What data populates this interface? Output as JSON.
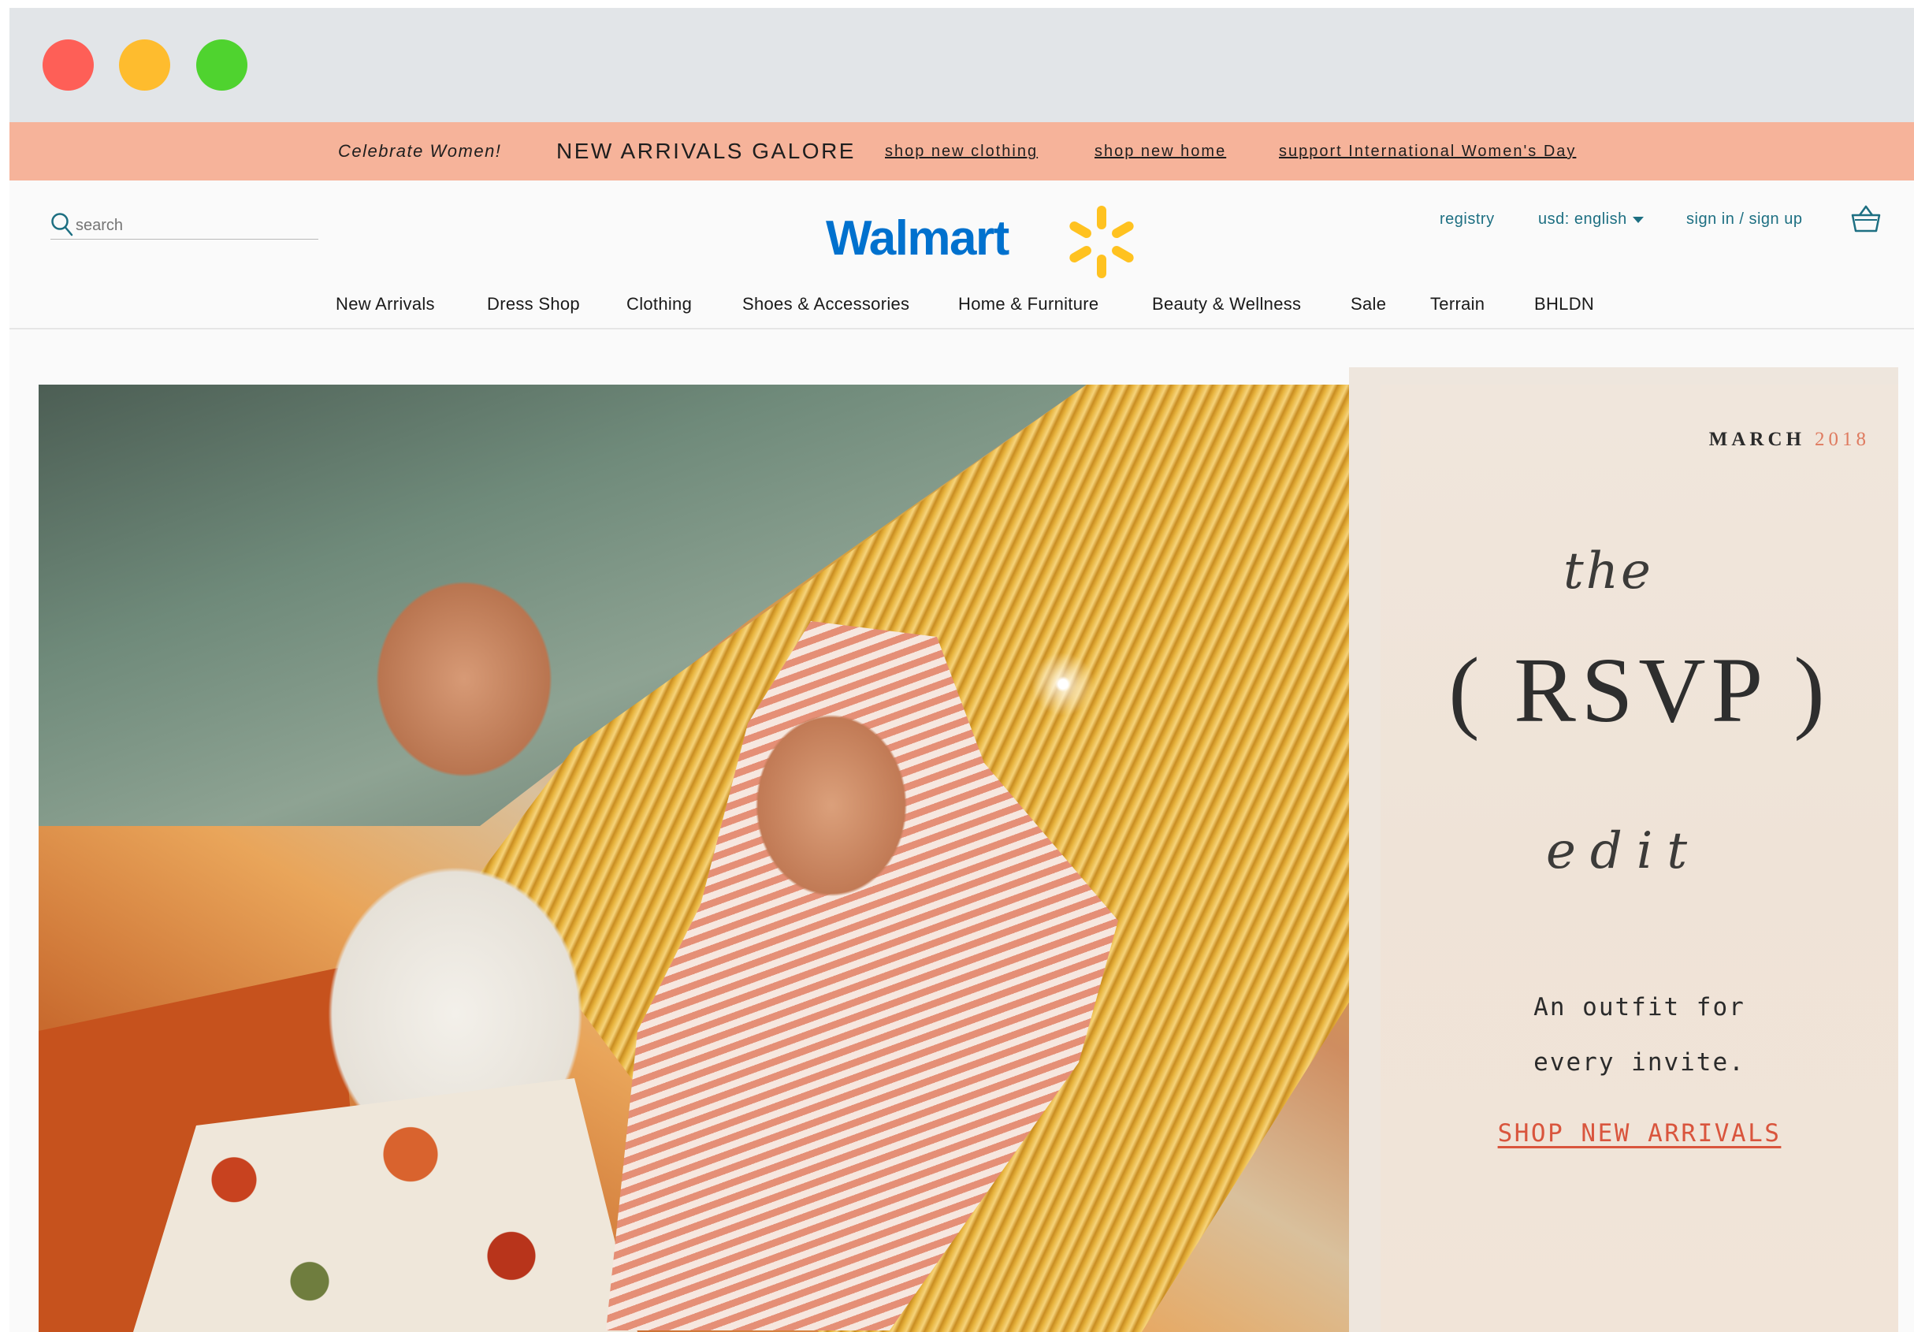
{
  "window": {
    "controls": [
      "close",
      "minimize",
      "maximize"
    ]
  },
  "promo_bar": {
    "tagline": "Celebrate Women!",
    "headline": "NEW ARRIVALS GALORE",
    "links": [
      "shop new clothing",
      "shop new home",
      "support International Women's Day"
    ]
  },
  "header": {
    "search_placeholder": "search",
    "logo_text": "Walmart",
    "registry_label": "registry",
    "currency_label": "usd: english",
    "sign_in_label": "sign in / sign up",
    "icons": [
      "search-icon",
      "spark-logo-icon",
      "chevron-down-icon",
      "shopping-basket-icon"
    ]
  },
  "nav": {
    "items": [
      "New Arrivals",
      "Dress Shop",
      "Clothing",
      "Shoes & Accessories",
      "Home & Furniture",
      "Beauty & Wellness",
      "Sale",
      "Terrain",
      "BHLDN"
    ]
  },
  "hero_panel": {
    "month": "MARCH",
    "year": "2018",
    "script_top": "the",
    "title": "( RSVP )",
    "script_bottom": "edit",
    "subtitle_line1": "An outfit for",
    "subtitle_line2": "every invite.",
    "cta": "SHOP NEW ARRIVALS"
  },
  "colors": {
    "promo_bg": "#f6b39a",
    "brand_blue": "#0071ce",
    "brand_yellow": "#ffc220",
    "link_teal": "#1d6f82",
    "cta_red": "#d9553d",
    "panel_bg": "#efe4d8"
  }
}
